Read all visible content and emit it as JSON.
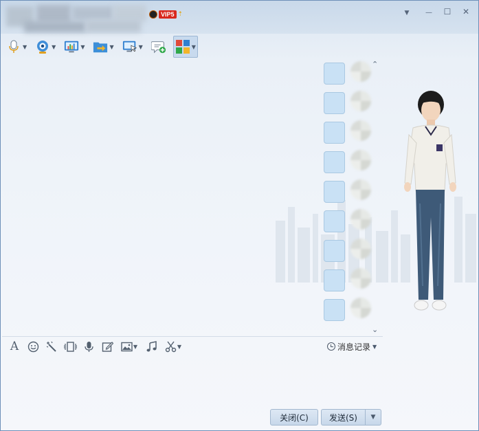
{
  "titlebar": {
    "vip_label": "VIP5",
    "vip_up": "⇡",
    "minimize_glyph": "—",
    "maximize_glyph": "☐",
    "close_glyph": "✕",
    "dropdown_glyph": "▼"
  },
  "toolbar": {
    "items": [
      {
        "name": "voice-call-button",
        "icon": "microphone-icon",
        "caret": "▼"
      },
      {
        "name": "video-call-button",
        "icon": "webcam-icon",
        "caret": "▼"
      },
      {
        "name": "remote-desktop-button",
        "icon": "screen-share-chart-icon",
        "caret": "▼"
      },
      {
        "name": "file-transfer-button",
        "icon": "folder-transfer-icon",
        "caret": "▼"
      },
      {
        "name": "remote-assist-button",
        "icon": "monitor-cursor-icon",
        "caret": "▼"
      },
      {
        "name": "create-discussion-button",
        "icon": "chat-add-icon",
        "caret": ""
      },
      {
        "name": "apps-button",
        "icon": "app-grid-icon",
        "caret": "▼"
      }
    ]
  },
  "apps_panel": {
    "up_glyph": "⌃",
    "down_glyph": "⌄",
    "count": 9
  },
  "input_tools": {
    "caret": "▼",
    "items": [
      "font-icon",
      "emoji-icon",
      "magic-wand-icon",
      "screenshot-shake-icon",
      "voice-message-icon",
      "edit-note-icon",
      "image-icon",
      "music-icon",
      "scissors-icon"
    ]
  },
  "history": {
    "label": "消息记录",
    "caret": "▼"
  },
  "buttons": {
    "close": "关闭(C)",
    "send": "发送(S)",
    "send_caret": "▼"
  },
  "colors": {
    "accent": "#c8daee",
    "app_tile": "#c9e1f5",
    "button": "#d4e1ef"
  }
}
